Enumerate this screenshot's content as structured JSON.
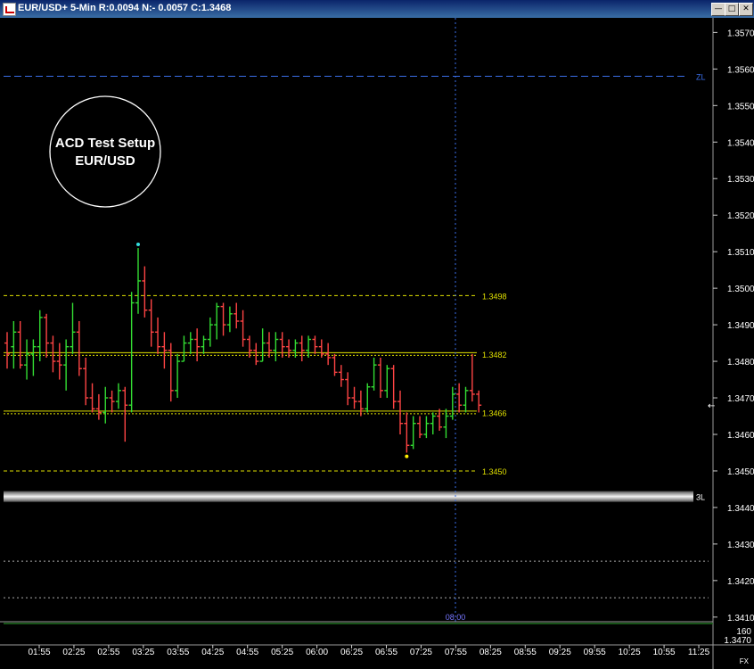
{
  "window": {
    "title": "EUR/USD+ 5-Min R:0.0094 N:- 0.0057 C:1.3468",
    "minimize_glyph": "—",
    "maximize_glyph": "□",
    "close_glyph": "✕"
  },
  "annotation": {
    "line1": "ACD Test Setup",
    "line2": "EUR/USD"
  },
  "colors": {
    "background": "#000000",
    "up_bar": "#33dd33",
    "down_bar": "#ff4444",
    "yellow_line": "#e0e000",
    "blue_dashed": "#3a6ee8",
    "white_dotted": "#aaaaaa",
    "axis_text": "#ffffff",
    "cyan_dot": "#33dddd",
    "yellow_dot": "#ffee00",
    "time_marker_text": "#7777ff"
  },
  "chart_data": {
    "type": "candlestick_ohlc",
    "ylim": [
      1.3408,
      1.3574
    ],
    "y_ticks": [
      "1.3570",
      "1.3560",
      "1.3550",
      "1.3540",
      "1.3530",
      "1.3520",
      "1.3510",
      "1.3500",
      "1.3490",
      "1.3480",
      "1.3470",
      "1.3460",
      "1.3450",
      "1.3440",
      "1.3430",
      "1.3420",
      "1.3410"
    ],
    "x_labels": [
      "01:55",
      "02:25",
      "02:55",
      "03:25",
      "03:55",
      "04:25",
      "04:55",
      "05:25",
      "06:00",
      "06:25",
      "06:55",
      "07:25",
      "07:55",
      "08:25",
      "08:55",
      "09:25",
      "09:55",
      "10:25",
      "10:55",
      "11:25"
    ],
    "levels": [
      {
        "label": "1.3498",
        "value": 1.3498,
        "style": "dashed-yellow"
      },
      {
        "label": "1.3482",
        "value": 1.3482,
        "style": "solid-yellow"
      },
      {
        "label": "1.3466",
        "value": 1.3466,
        "style": "solid-yellow"
      },
      {
        "label": "1.3450",
        "value": 1.345,
        "style": "dashed-yellow"
      },
      {
        "label": "ZL",
        "value": 1.3558,
        "style": "dashed-blue"
      },
      {
        "label": "3L",
        "value": 1.3443,
        "style": "thick-grey"
      },
      {
        "label": "",
        "value": 1.34253,
        "style": "dotted-white"
      },
      {
        "label": "",
        "value": 1.34153,
        "style": "dotted-white"
      }
    ],
    "bars": [
      {
        "o": 1.3485,
        "h": 1.3488,
        "l": 1.3478,
        "c": 1.3482
      },
      {
        "o": 1.3484,
        "h": 1.3491,
        "l": 1.3478,
        "c": 1.3488
      },
      {
        "o": 1.3488,
        "h": 1.3491,
        "l": 1.3478,
        "c": 1.3479
      },
      {
        "o": 1.3479,
        "h": 1.3486,
        "l": 1.3475,
        "c": 1.3482
      },
      {
        "o": 1.3482,
        "h": 1.3486,
        "l": 1.3476,
        "c": 1.3484
      },
      {
        "o": 1.3484,
        "h": 1.3494,
        "l": 1.348,
        "c": 1.3492
      },
      {
        "o": 1.3492,
        "h": 1.3493,
        "l": 1.3481,
        "c": 1.3485
      },
      {
        "o": 1.3485,
        "h": 1.3487,
        "l": 1.3477,
        "c": 1.348
      },
      {
        "o": 1.348,
        "h": 1.3485,
        "l": 1.3475,
        "c": 1.3479
      },
      {
        "o": 1.3479,
        "h": 1.3486,
        "l": 1.3472,
        "c": 1.3484
      },
      {
        "o": 1.3484,
        "h": 1.3496,
        "l": 1.3482,
        "c": 1.3488
      },
      {
        "o": 1.3488,
        "h": 1.3491,
        "l": 1.3476,
        "c": 1.3478
      },
      {
        "o": 1.3478,
        "h": 1.3481,
        "l": 1.3468,
        "c": 1.347
      },
      {
        "o": 1.347,
        "h": 1.3474,
        "l": 1.3466,
        "c": 1.3467
      },
      {
        "o": 1.3467,
        "h": 1.3471,
        "l": 1.3464,
        "c": 1.3466
      },
      {
        "o": 1.3466,
        "h": 1.3473,
        "l": 1.3463,
        "c": 1.347
      },
      {
        "o": 1.347,
        "h": 1.3472,
        "l": 1.3466,
        "c": 1.3469
      },
      {
        "o": 1.3469,
        "h": 1.3474,
        "l": 1.3467,
        "c": 1.3472
      },
      {
        "o": 1.3472,
        "h": 1.3473,
        "l": 1.3458,
        "c": 1.3468
      },
      {
        "o": 1.3468,
        "h": 1.3499,
        "l": 1.3466,
        "c": 1.3496
      },
      {
        "o": 1.3496,
        "h": 1.3511,
        "l": 1.3493,
        "c": 1.3502
      },
      {
        "o": 1.3502,
        "h": 1.3506,
        "l": 1.3492,
        "c": 1.3494
      },
      {
        "o": 1.3494,
        "h": 1.3497,
        "l": 1.3484,
        "c": 1.3488
      },
      {
        "o": 1.3488,
        "h": 1.3492,
        "l": 1.3482,
        "c": 1.3484
      },
      {
        "o": 1.3484,
        "h": 1.3488,
        "l": 1.3478,
        "c": 1.3483
      },
      {
        "o": 1.3483,
        "h": 1.3485,
        "l": 1.3469,
        "c": 1.3472
      },
      {
        "o": 1.3472,
        "h": 1.3482,
        "l": 1.347,
        "c": 1.348
      },
      {
        "o": 1.348,
        "h": 1.3487,
        "l": 1.348,
        "c": 1.3485
      },
      {
        "o": 1.3485,
        "h": 1.3488,
        "l": 1.3482,
        "c": 1.3486
      },
      {
        "o": 1.3486,
        "h": 1.3489,
        "l": 1.348,
        "c": 1.3484
      },
      {
        "o": 1.3484,
        "h": 1.3487,
        "l": 1.3482,
        "c": 1.3486
      },
      {
        "o": 1.3486,
        "h": 1.3492,
        "l": 1.3484,
        "c": 1.349
      },
      {
        "o": 1.349,
        "h": 1.3496,
        "l": 1.3486,
        "c": 1.3495
      },
      {
        "o": 1.3495,
        "h": 1.3496,
        "l": 1.3487,
        "c": 1.349
      },
      {
        "o": 1.349,
        "h": 1.3495,
        "l": 1.3488,
        "c": 1.3493
      },
      {
        "o": 1.3493,
        "h": 1.3496,
        "l": 1.3489,
        "c": 1.3491
      },
      {
        "o": 1.3491,
        "h": 1.3494,
        "l": 1.3484,
        "c": 1.3486
      },
      {
        "o": 1.3486,
        "h": 1.3487,
        "l": 1.3481,
        "c": 1.3483
      },
      {
        "o": 1.3483,
        "h": 1.3485,
        "l": 1.3479,
        "c": 1.348
      },
      {
        "o": 1.348,
        "h": 1.3489,
        "l": 1.348,
        "c": 1.3485
      },
      {
        "o": 1.3485,
        "h": 1.3488,
        "l": 1.3481,
        "c": 1.3483
      },
      {
        "o": 1.3483,
        "h": 1.3488,
        "l": 1.348,
        "c": 1.3486
      },
      {
        "o": 1.3486,
        "h": 1.3488,
        "l": 1.3481,
        "c": 1.3484
      },
      {
        "o": 1.3484,
        "h": 1.3486,
        "l": 1.3481,
        "c": 1.3483
      },
      {
        "o": 1.3483,
        "h": 1.3486,
        "l": 1.3481,
        "c": 1.3485
      },
      {
        "o": 1.3485,
        "h": 1.3487,
        "l": 1.348,
        "c": 1.3483
      },
      {
        "o": 1.3483,
        "h": 1.3487,
        "l": 1.3481,
        "c": 1.3486
      },
      {
        "o": 1.3486,
        "h": 1.3487,
        "l": 1.3482,
        "c": 1.3484
      },
      {
        "o": 1.3484,
        "h": 1.3486,
        "l": 1.3481,
        "c": 1.3482
      },
      {
        "o": 1.3482,
        "h": 1.3485,
        "l": 1.3479,
        "c": 1.3481
      },
      {
        "o": 1.3481,
        "h": 1.3482,
        "l": 1.3476,
        "c": 1.3477
      },
      {
        "o": 1.3477,
        "h": 1.3479,
        "l": 1.3473,
        "c": 1.3475
      },
      {
        "o": 1.3475,
        "h": 1.3477,
        "l": 1.3468,
        "c": 1.347
      },
      {
        "o": 1.347,
        "h": 1.3473,
        "l": 1.3467,
        "c": 1.3469
      },
      {
        "o": 1.3469,
        "h": 1.3472,
        "l": 1.3465,
        "c": 1.3467
      },
      {
        "o": 1.3467,
        "h": 1.3474,
        "l": 1.3466,
        "c": 1.3473
      },
      {
        "o": 1.3473,
        "h": 1.3481,
        "l": 1.3472,
        "c": 1.3479
      },
      {
        "o": 1.3479,
        "h": 1.3481,
        "l": 1.347,
        "c": 1.3472
      },
      {
        "o": 1.3472,
        "h": 1.3479,
        "l": 1.347,
        "c": 1.3478
      },
      {
        "o": 1.3478,
        "h": 1.3479,
        "l": 1.3467,
        "c": 1.3469
      },
      {
        "o": 1.3469,
        "h": 1.3472,
        "l": 1.346,
        "c": 1.3463
      },
      {
        "o": 1.3463,
        "h": 1.3466,
        "l": 1.3455,
        "c": 1.3457
      },
      {
        "o": 1.3457,
        "h": 1.3465,
        "l": 1.3456,
        "c": 1.3463
      },
      {
        "o": 1.3463,
        "h": 1.3465,
        "l": 1.3459,
        "c": 1.346
      },
      {
        "o": 1.346,
        "h": 1.3465,
        "l": 1.3459,
        "c": 1.3463
      },
      {
        "o": 1.3463,
        "h": 1.3466,
        "l": 1.346,
        "c": 1.3465
      },
      {
        "o": 1.3465,
        "h": 1.3467,
        "l": 1.3461,
        "c": 1.3462
      },
      {
        "o": 1.3462,
        "h": 1.3467,
        "l": 1.3459,
        "c": 1.3465
      },
      {
        "o": 1.3465,
        "h": 1.3473,
        "l": 1.3464,
        "c": 1.3471
      },
      {
        "o": 1.3471,
        "h": 1.3474,
        "l": 1.3466,
        "c": 1.3468
      },
      {
        "o": 1.3468,
        "h": 1.3473,
        "l": 1.3466,
        "c": 1.3472
      },
      {
        "o": 1.3472,
        "h": 1.3482,
        "l": 1.3469,
        "c": 1.3471
      },
      {
        "o": 1.3471,
        "h": 1.3472,
        "l": 1.3466,
        "c": 1.3468
      }
    ],
    "high_marker": {
      "bar_index": 20,
      "value": 1.3512
    },
    "low_marker": {
      "bar_index": 61,
      "value": 1.3454
    },
    "time_marker": "08:00",
    "price_marker": "←",
    "panel": {
      "value1": "160",
      "value2": "1.3470",
      "corner": "FX"
    }
  }
}
